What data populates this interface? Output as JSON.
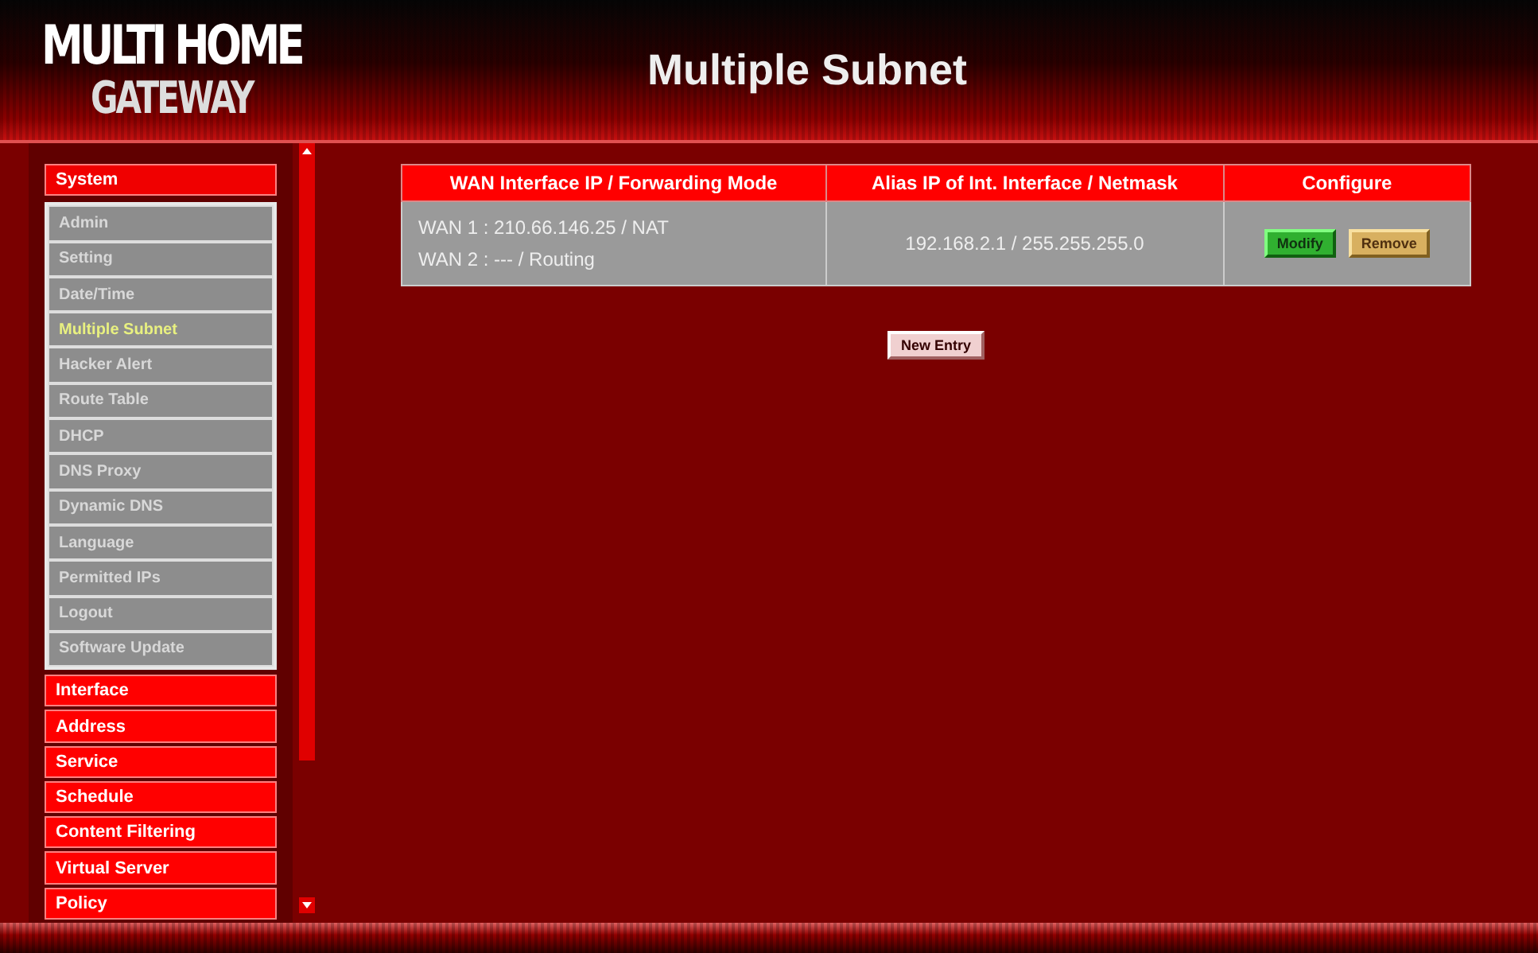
{
  "logo": {
    "line_1": "MULTI HOME",
    "line_2": "GATEWAY"
  },
  "page_title": "Multiple Subnet",
  "sidebar": {
    "sections": [
      {
        "label": "System",
        "expanded": true,
        "children": [
          {
            "label": "Admin",
            "selected": false
          },
          {
            "label": "Setting",
            "selected": false
          },
          {
            "label": "Date/Time",
            "selected": false
          },
          {
            "label": "Multiple Subnet",
            "selected": true
          },
          {
            "label": "Hacker Alert",
            "selected": false
          },
          {
            "label": "Route Table",
            "selected": false
          },
          {
            "label": "DHCP",
            "selected": false
          },
          {
            "label": "DNS Proxy",
            "selected": false
          },
          {
            "label": "Dynamic DNS",
            "selected": false
          },
          {
            "label": "Language",
            "selected": false
          },
          {
            "label": "Permitted IPs",
            "selected": false
          },
          {
            "label": "Logout",
            "selected": false
          },
          {
            "label": "Software Update",
            "selected": false
          }
        ]
      },
      {
        "label": "Interface",
        "expanded": false
      },
      {
        "label": "Address",
        "expanded": false
      },
      {
        "label": "Service",
        "expanded": false
      },
      {
        "label": "Schedule",
        "expanded": false
      },
      {
        "label": "Content Filtering",
        "expanded": false
      },
      {
        "label": "Virtual Server",
        "expanded": false
      },
      {
        "label": "Policy",
        "expanded": false
      }
    ]
  },
  "table": {
    "columns": [
      "WAN Interface IP / Forwarding Mode",
      "Alias IP of Int. Interface / Netmask",
      "Configure"
    ],
    "rows": [
      {
        "wan": [
          "WAN 1 : 210.66.146.25 / NAT",
          "WAN 2 : --- / Routing"
        ],
        "alias": "192.168.2.1 / 255.255.255.0",
        "actions": [
          {
            "label": "Modify",
            "kind": "modify"
          },
          {
            "label": "Remove",
            "kind": "remove"
          }
        ]
      }
    ]
  },
  "new_entry_button": "New Entry"
}
